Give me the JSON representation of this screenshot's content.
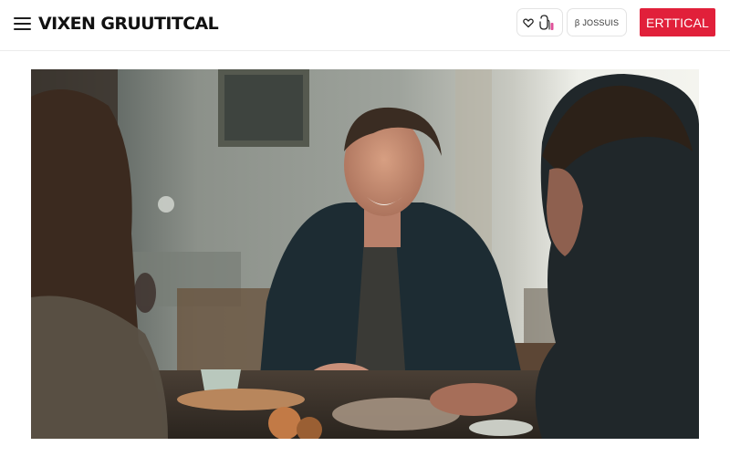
{
  "header": {
    "menu_icon": "hamburger-menu-icon",
    "brand": "VIXEN GRUUTITCAL",
    "icon_pill_icons": [
      "heart-icon",
      "shopping-bag-icon"
    ],
    "secondary_pill_label": "ꞵ JOSSUIS",
    "cta_label": "ERTTICAL"
  },
  "hero": {
    "image_subject": "three people talking at a dinner table",
    "icon": "photo"
  },
  "colors": {
    "accent": "#e1203a",
    "brand_text": "#111111",
    "background": "#ffffff",
    "pill_icon_pink": "#e0519a"
  }
}
